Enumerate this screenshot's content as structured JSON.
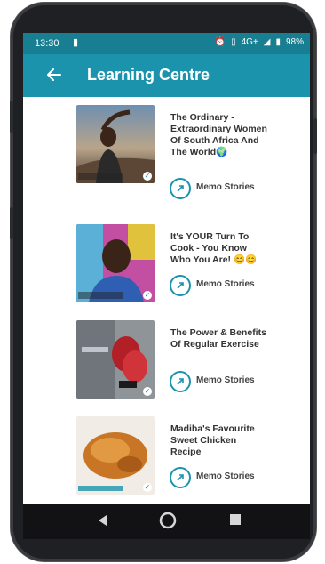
{
  "status": {
    "time": "13:30",
    "network": "4G+",
    "battery": "98%"
  },
  "appbar": {
    "title": "Learning Centre"
  },
  "articles": [
    {
      "title": "The Ordinary - Extraordinary Women Of South Africa And The World🌍",
      "source": "Memo Stories"
    },
    {
      "title": "It's YOUR Turn To Cook - You Know Who You Are! 😊😊",
      "source": "Memo Stories"
    },
    {
      "title": "The Power & Benefits Of Regular Exercise",
      "source": "Memo Stories"
    },
    {
      "title": "Madiba's Favourite Sweet Chicken Recipe",
      "source": "Memo Stories"
    }
  ],
  "colors": {
    "appbar": "#1c93ad",
    "statusbar": "#187f92"
  },
  "icons": [
    "back-arrow-icon",
    "nav-back-icon",
    "nav-home-icon",
    "nav-recents-icon",
    "link-icon"
  ]
}
